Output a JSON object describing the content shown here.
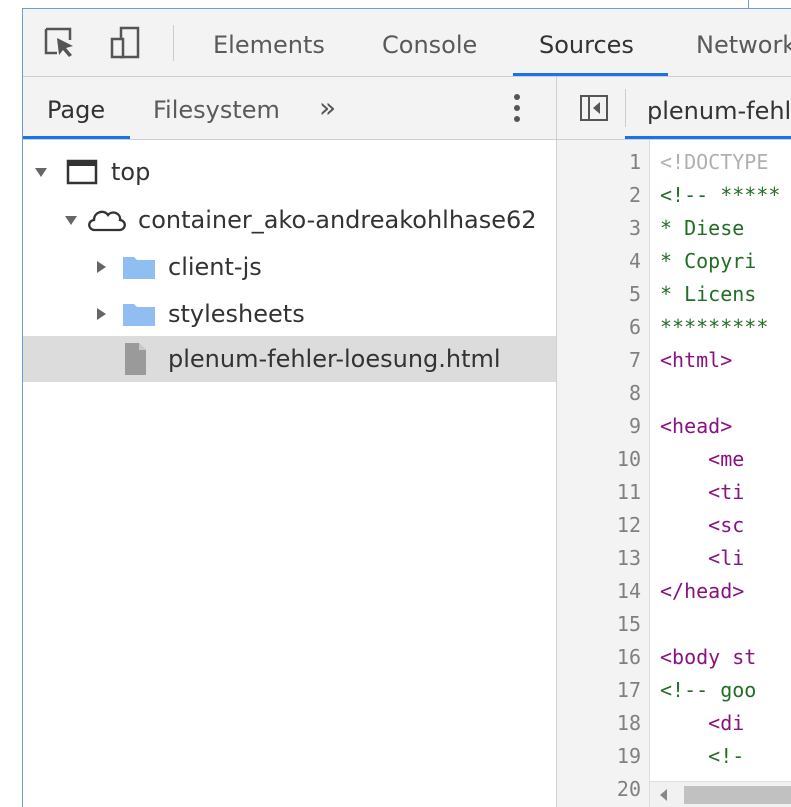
{
  "toolbar": {
    "tabs": [
      {
        "label": "Elements"
      },
      {
        "label": "Console"
      },
      {
        "label": "Sources"
      },
      {
        "label": "Network"
      }
    ],
    "active_tab": "Sources"
  },
  "navigator": {
    "tabs": [
      {
        "label": "Page"
      },
      {
        "label": "Filesystem"
      }
    ],
    "more_label": "»",
    "tree": [
      {
        "label": "top",
        "icon": "frame-icon",
        "expanded": true
      },
      {
        "label": "container_ako-andreakohlhase62",
        "icon": "cloud-icon",
        "expanded": true
      },
      {
        "label": "client-js",
        "icon": "folder-icon",
        "expanded": false
      },
      {
        "label": "stylesheets",
        "icon": "folder-icon",
        "expanded": false
      },
      {
        "label": "plenum-fehler-loesung.html",
        "icon": "file-icon",
        "selected": true
      }
    ]
  },
  "editor": {
    "file_tab": "plenum-fehler-loesung.html",
    "line_numbers": [
      "1",
      "2",
      "3",
      "4",
      "5",
      "6",
      "7",
      "8",
      "9",
      "10",
      "11",
      "12",
      "13",
      "14",
      "15",
      "16",
      "17",
      "18",
      "19",
      "20"
    ],
    "lines": [
      "<!DOCTYPE",
      "<!-- *****",
      "* Diese ",
      "* Copyri",
      "* Licens",
      "*********",
      "<html>",
      "",
      "<head>",
      "    <me",
      "    <ti",
      "    <sc",
      "    <li",
      "</head>",
      "",
      "<body st",
      "<!-- goo",
      "    <di",
      "    <!-",
      ""
    ]
  },
  "colors": {
    "accent": "#1a73e8",
    "comment": "#236e25",
    "tag": "#881280"
  }
}
